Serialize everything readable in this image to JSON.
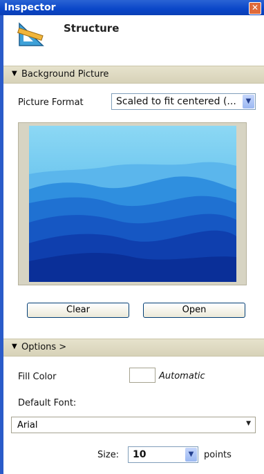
{
  "window": {
    "title": "Inspector",
    "close_icon": "close-icon"
  },
  "header": {
    "title": "Structure",
    "icon": "structure-icon"
  },
  "background_section": {
    "label": "Background Picture",
    "picture_format_label": "Picture Format",
    "picture_format_value": "Scaled to fit centered (...",
    "clear_label": "Clear",
    "open_label": "Open"
  },
  "options_section": {
    "label": "Options >",
    "fill_color_label": "Fill Color",
    "fill_color_value": "Automatic",
    "default_font_label": "Default Font:",
    "default_font_value": "Arial",
    "size_label": "Size:",
    "size_value": "10",
    "size_unit": "points"
  },
  "colors": {
    "titlebar": "#0a46c8",
    "accent": "#003c74"
  }
}
